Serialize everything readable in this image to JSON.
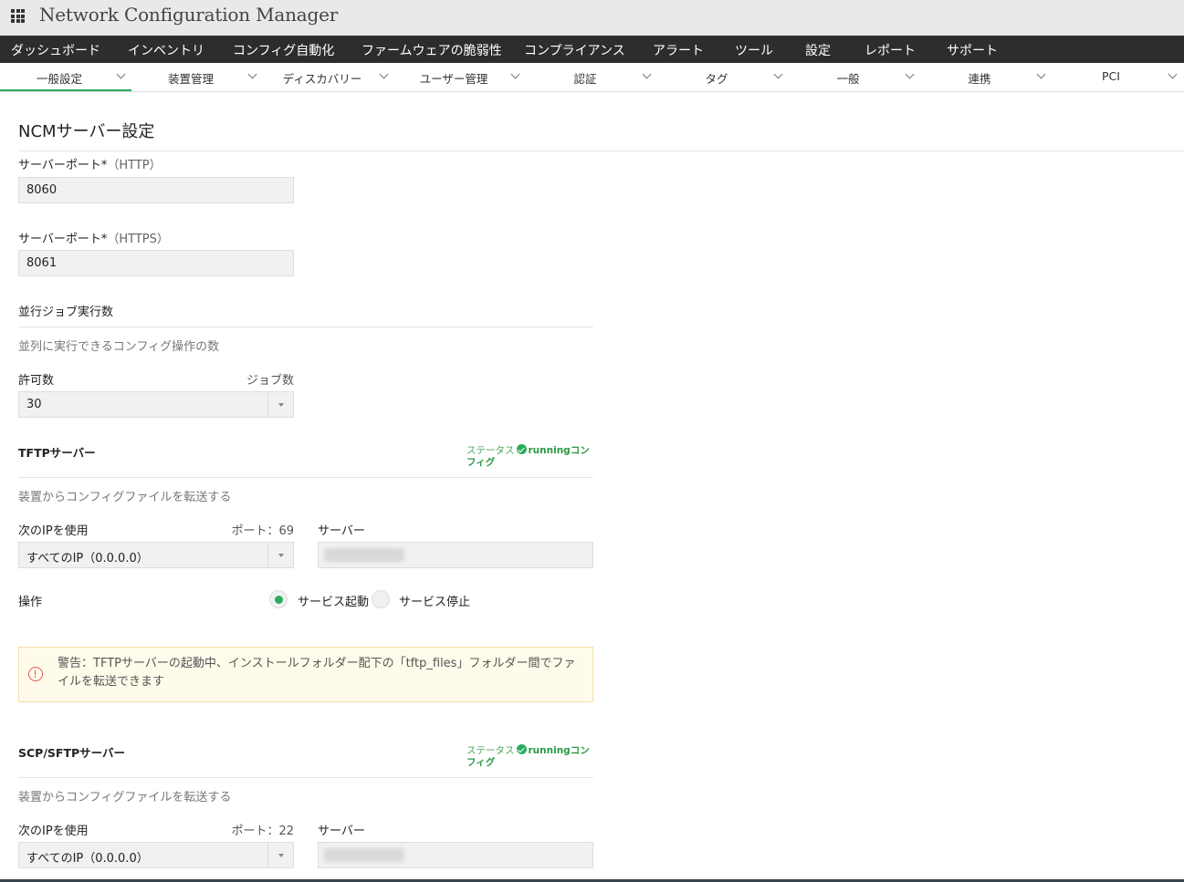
{
  "app": {
    "title": "Network Configuration Manager"
  },
  "main_nav": [
    "ダッシュボード",
    "インベントリ",
    "コンフィグ自動化",
    "ファームウェアの脆弱性",
    "コンプライアンス",
    "アラート",
    "ツール",
    "設定",
    "レポート",
    "サポート"
  ],
  "sub_nav": [
    {
      "label": "一般設定",
      "active": true
    },
    {
      "label": "装置管理"
    },
    {
      "label": "ディスカバリー"
    },
    {
      "label": "ユーザー管理"
    },
    {
      "label": "認証"
    },
    {
      "label": "タグ"
    },
    {
      "label": "一般"
    },
    {
      "label": "連携"
    },
    {
      "label": "PCI"
    }
  ],
  "page": {
    "title": "NCMサーバー設定"
  },
  "http": {
    "label": "サーバーポート*",
    "paren": "（HTTP）",
    "value": "8060"
  },
  "https": {
    "label": "サーバーポート*",
    "paren": "（HTTPS）",
    "value": "8061"
  },
  "jobs": {
    "heading": "並行ジョブ実行数",
    "description": "並列に実行できるコンフィグ操作の数",
    "allowed_label": "許可数",
    "jobs_label": "ジョブ数",
    "allowed_value": "30"
  },
  "tftp": {
    "heading": "TFTPサーバー",
    "status_label": "ステータス",
    "status_value": "runningコンフィグ",
    "description": "装置からコンフィグファイルを転送する",
    "ip_label": "次のIPを使用",
    "port_label": "ポート：69",
    "server_label": "サーバー",
    "ip_value": "すべてのIP（0.0.0.0）",
    "operation_label": "操作",
    "start_label": "サービス起動",
    "stop_label": "サービス停止",
    "start_selected": true,
    "warning": "警告：TFTPサーバーの起動中、インストールフォルダー配下の「tftp_files」フォルダー間でファイルを転送できます"
  },
  "scp": {
    "heading": "SCP/SFTPサーバー",
    "status_label": "ステータス",
    "status_value": "runningコンフィグ",
    "description": "装置からコンフィグファイルを転送する",
    "ip_label": "次のIPを使用",
    "port_label": "ポート：22",
    "server_label": "サーバー",
    "ip_value": "すべてのIP（0.0.0.0）"
  },
  "colors": {
    "accent": "#2bab5e",
    "nav_bg": "#2d2d2d",
    "warning_bg": "#fffbea"
  },
  "icons": {
    "app_menu": "grid-icon",
    "status": "check-circle-icon",
    "warning": "exclamation-circle-icon",
    "dropdown": "caret-down-icon"
  }
}
